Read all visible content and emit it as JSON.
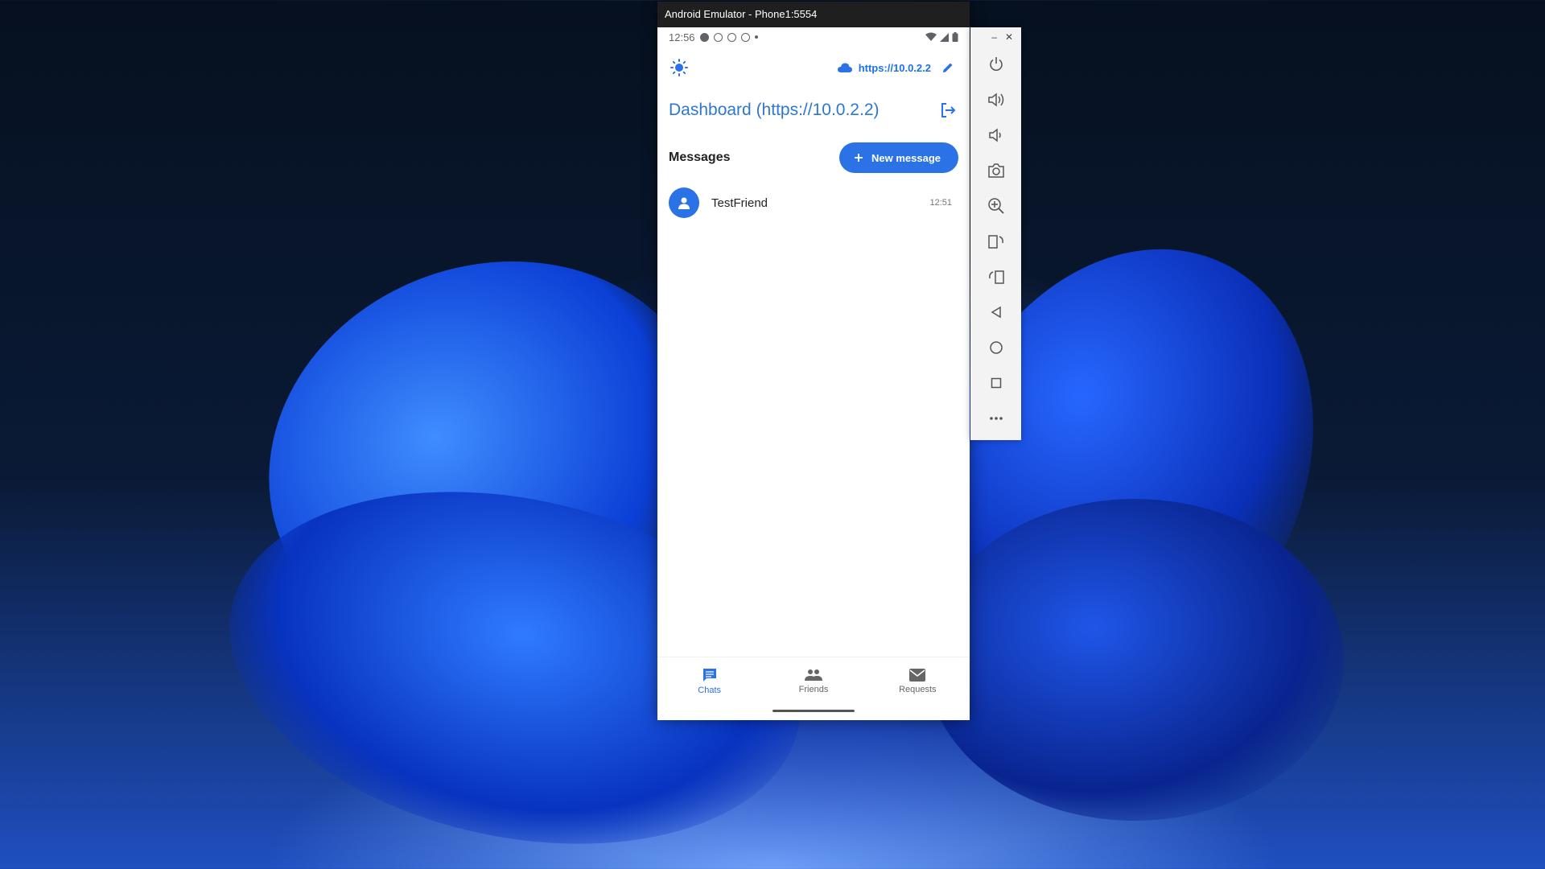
{
  "window": {
    "title": "Android Emulator - Phone1:5554"
  },
  "status_bar": {
    "time": "12:56"
  },
  "app": {
    "server_label": "https://10.0.2.2",
    "dashboard_title": "Dashboard (https://10.0.2.2)",
    "messages_heading": "Messages",
    "new_message_label": "New message"
  },
  "chats": [
    {
      "name": "TestFriend",
      "time": "12:51"
    }
  ],
  "bottom_nav": {
    "items": [
      {
        "label": "Chats",
        "icon": "chat-icon",
        "active": true
      },
      {
        "label": "Friends",
        "icon": "people-icon",
        "active": false
      },
      {
        "label": "Requests",
        "icon": "mail-icon",
        "active": false
      }
    ]
  },
  "side_toolbar": {
    "window_controls": [
      "minimize-icon",
      "close-icon"
    ],
    "tools": [
      "power-icon",
      "volume-up-icon",
      "volume-down-icon",
      "camera-icon",
      "zoom-icon",
      "rotate-left-icon",
      "rotate-right-icon",
      "back-icon",
      "home-icon",
      "overview-icon",
      "more-icon"
    ]
  },
  "colors": {
    "accent": "#2b72e6",
    "title_bar": "#1f1f1f",
    "dashboard_title": "#2e77d0"
  }
}
